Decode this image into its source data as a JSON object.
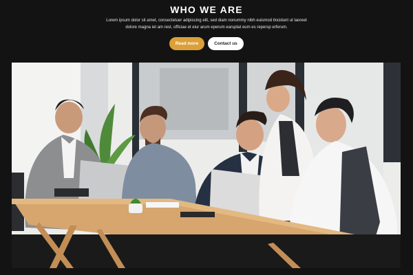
{
  "section": {
    "title": "WHO WE ARE",
    "description": "Lorem ipsum dolor sit amet, consectetuer adipiscing elit, sed diam nonummy nibh euismod tincidunt ut laoreet dolore magna iet am rest, officiae et eiur arum eperum earuptat eum es repersp erferum."
  },
  "buttons": {
    "primary_label": "Read more",
    "secondary_label": "Contact us"
  },
  "colors": {
    "background": "#131313",
    "accent": "#dca03a",
    "button_secondary_bg": "#ffffff"
  },
  "photo": {
    "alt": "Team meeting around a wooden table with laptops"
  }
}
